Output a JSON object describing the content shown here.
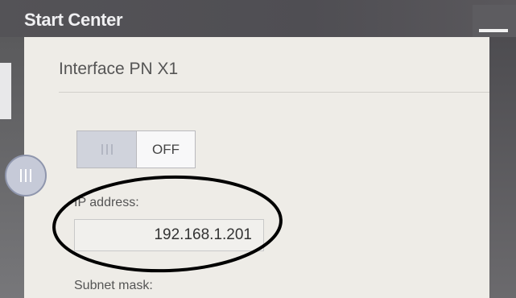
{
  "window": {
    "title": "Start Center"
  },
  "panel": {
    "heading": "Interface PN X1"
  },
  "toggle": {
    "off_label": "OFF",
    "state": "on"
  },
  "fields": {
    "ip_label": "IP address:",
    "ip_value": "192.168.1.201",
    "subnet_label": "Subnet mask:"
  },
  "colors": {
    "titlebar": "#4f4e53",
    "panel": "#eeece7",
    "toggle_on": "#d0d3dc",
    "annotation": "#000000"
  },
  "icons": {
    "minimize": "minimize-icon",
    "handle": "grip-lines-icon"
  }
}
